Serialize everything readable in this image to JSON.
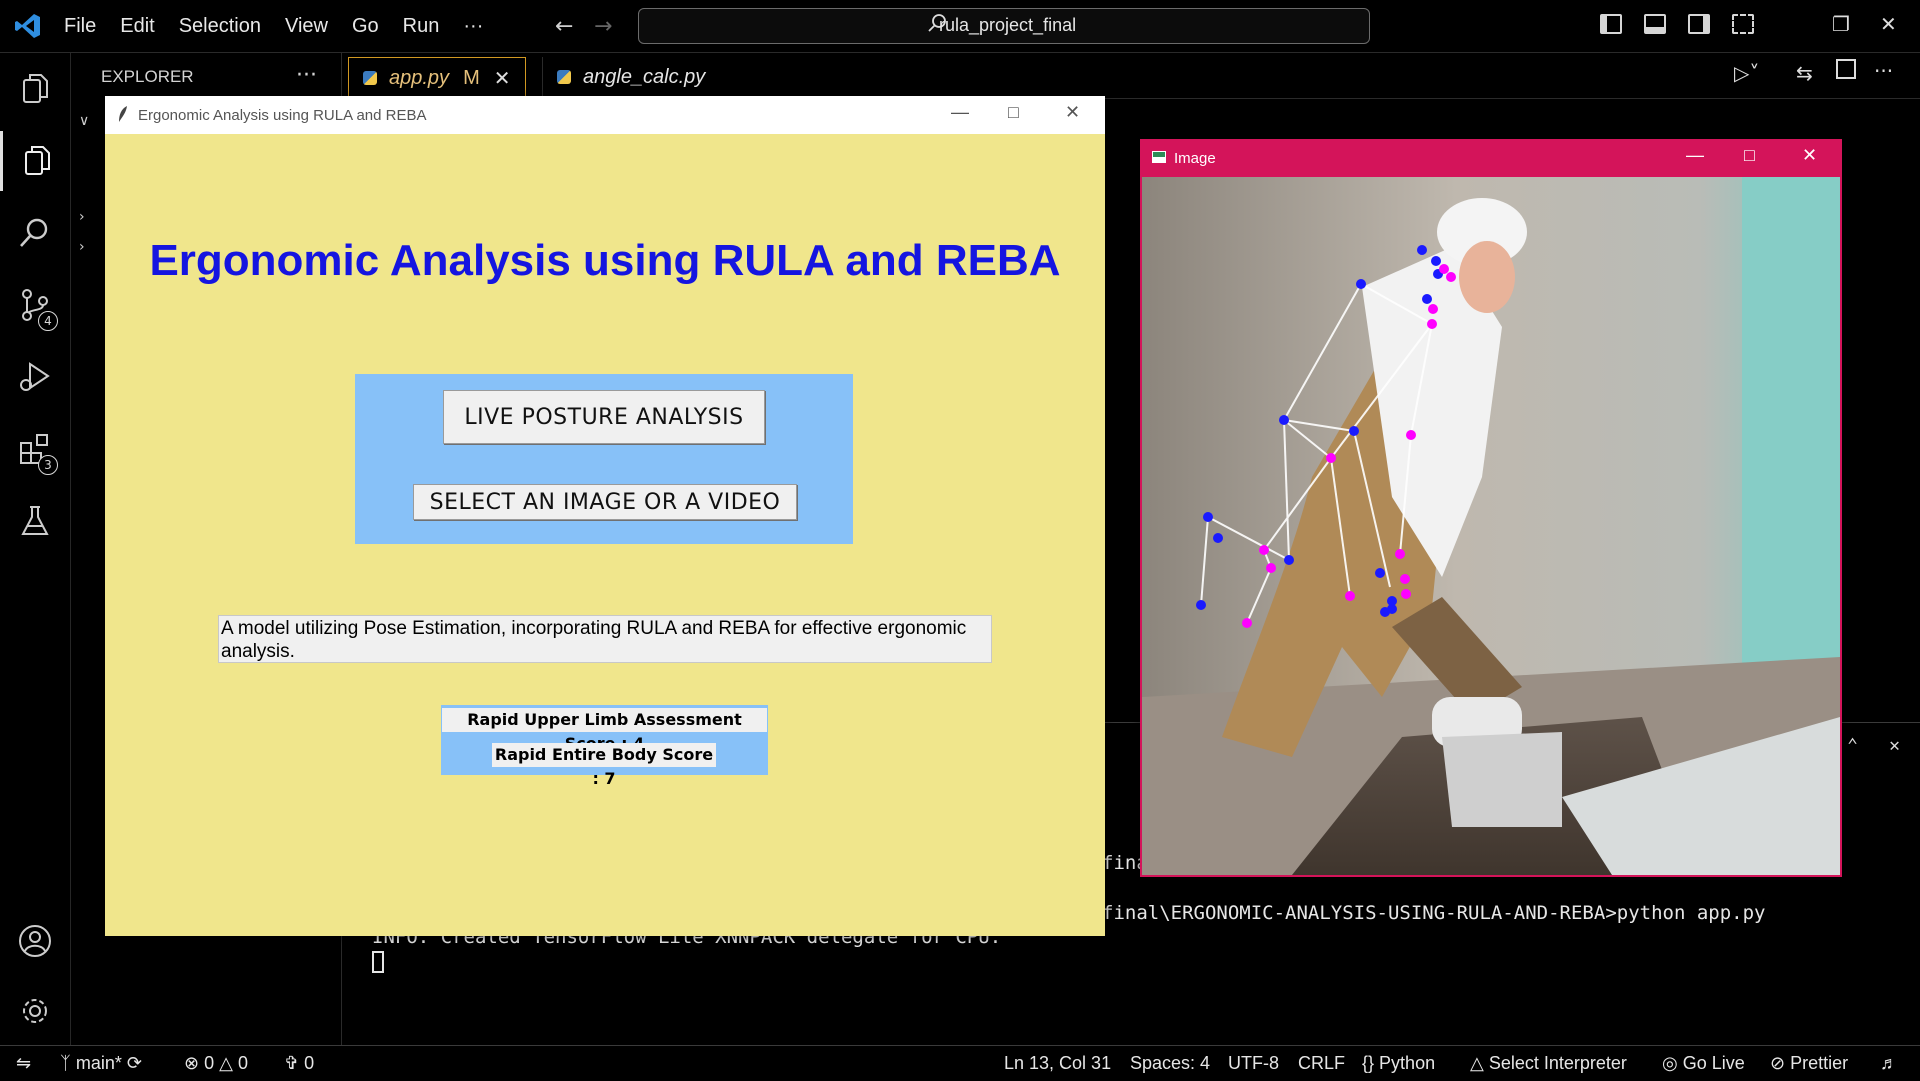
{
  "titlebar": {
    "menu": [
      "File",
      "Edit",
      "Selection",
      "View",
      "Go",
      "Run",
      "···"
    ],
    "search_text": "rula_project_final"
  },
  "activity_badges": {
    "source_control": "4",
    "extensions": "3"
  },
  "sidebar": {
    "header": "EXPLORER",
    "more": "···"
  },
  "tabs": [
    {
      "label": "app.py",
      "modified": "M"
    },
    {
      "label": "angle_calc.py"
    }
  ],
  "terminal": {
    "line_partial_1": "fina",
    "line_cmd": "final\\ERGONOMIC-ANALYSIS-USING-RULA-AND-REBA>python app.py",
    "line_info": "INFO: Created TensorFlow Lite XNNPACK delegate for CPU."
  },
  "statusbar": {
    "branch": "main*",
    "errors": "0",
    "warnings": "0",
    "ports": "0",
    "position": "Ln 13, Col 31",
    "spaces": "Spaces: 4",
    "encoding": "UTF-8",
    "eol": "CRLF",
    "language": "Python",
    "interpreter": "Select Interpreter",
    "golive": "Go Live",
    "prettier": "Prettier"
  },
  "app_window": {
    "title": "Ergonomic Analysis using RULA and REBA",
    "heading": "Ergonomic Analysis using RULA and REBA",
    "live_button": "LIVE POSTURE ANALYSIS",
    "select_button": "SELECT AN IMAGE OR A VIDEO",
    "description": "A model utilizing Pose Estimation, incorporating RULA and REBA for effective ergonomic analysis.",
    "rula_score": "Rapid Upper Limb Assessment Score : 4",
    "reba_score": "Rapid Entire Body Score : 7",
    "colors": {
      "background": "#f0e68c",
      "heading": "#1515e0",
      "panel": "#87c1f8"
    }
  },
  "image_window": {
    "title": "Image",
    "titlebar_color": "#d4145a"
  }
}
